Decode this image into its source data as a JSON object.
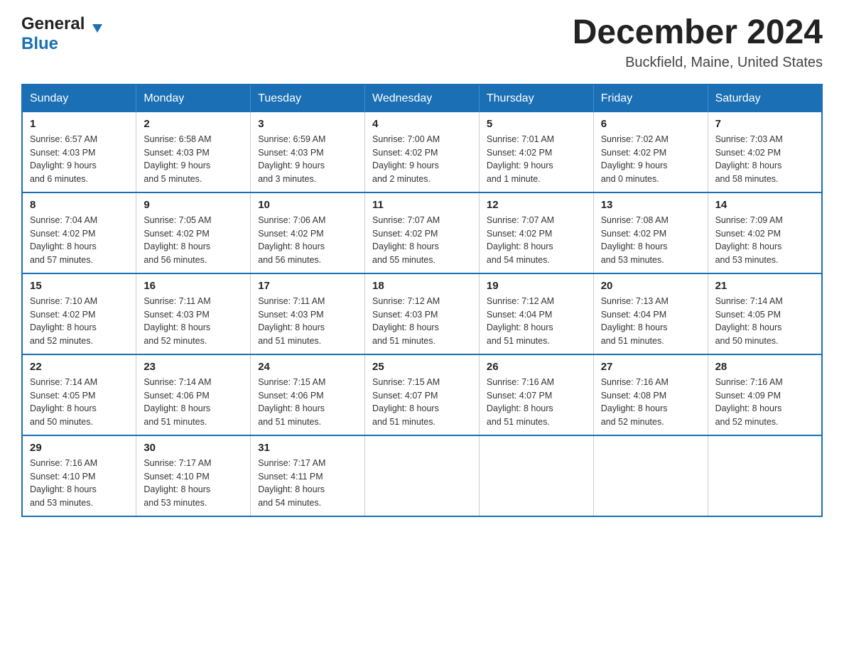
{
  "header": {
    "logo_line1": "General",
    "logo_line2": "Blue",
    "month_title": "December 2024",
    "location": "Buckfield, Maine, United States"
  },
  "weekdays": [
    "Sunday",
    "Monday",
    "Tuesday",
    "Wednesday",
    "Thursday",
    "Friday",
    "Saturday"
  ],
  "weeks": [
    [
      {
        "day": "1",
        "sunrise": "6:57 AM",
        "sunset": "4:03 PM",
        "daylight": "9 hours and 6 minutes."
      },
      {
        "day": "2",
        "sunrise": "6:58 AM",
        "sunset": "4:03 PM",
        "daylight": "9 hours and 5 minutes."
      },
      {
        "day": "3",
        "sunrise": "6:59 AM",
        "sunset": "4:03 PM",
        "daylight": "9 hours and 3 minutes."
      },
      {
        "day": "4",
        "sunrise": "7:00 AM",
        "sunset": "4:02 PM",
        "daylight": "9 hours and 2 minutes."
      },
      {
        "day": "5",
        "sunrise": "7:01 AM",
        "sunset": "4:02 PM",
        "daylight": "9 hours and 1 minute."
      },
      {
        "day": "6",
        "sunrise": "7:02 AM",
        "sunset": "4:02 PM",
        "daylight": "9 hours and 0 minutes."
      },
      {
        "day": "7",
        "sunrise": "7:03 AM",
        "sunset": "4:02 PM",
        "daylight": "8 hours and 58 minutes."
      }
    ],
    [
      {
        "day": "8",
        "sunrise": "7:04 AM",
        "sunset": "4:02 PM",
        "daylight": "8 hours and 57 minutes."
      },
      {
        "day": "9",
        "sunrise": "7:05 AM",
        "sunset": "4:02 PM",
        "daylight": "8 hours and 56 minutes."
      },
      {
        "day": "10",
        "sunrise": "7:06 AM",
        "sunset": "4:02 PM",
        "daylight": "8 hours and 56 minutes."
      },
      {
        "day": "11",
        "sunrise": "7:07 AM",
        "sunset": "4:02 PM",
        "daylight": "8 hours and 55 minutes."
      },
      {
        "day": "12",
        "sunrise": "7:07 AM",
        "sunset": "4:02 PM",
        "daylight": "8 hours and 54 minutes."
      },
      {
        "day": "13",
        "sunrise": "7:08 AM",
        "sunset": "4:02 PM",
        "daylight": "8 hours and 53 minutes."
      },
      {
        "day": "14",
        "sunrise": "7:09 AM",
        "sunset": "4:02 PM",
        "daylight": "8 hours and 53 minutes."
      }
    ],
    [
      {
        "day": "15",
        "sunrise": "7:10 AM",
        "sunset": "4:02 PM",
        "daylight": "8 hours and 52 minutes."
      },
      {
        "day": "16",
        "sunrise": "7:11 AM",
        "sunset": "4:03 PM",
        "daylight": "8 hours and 52 minutes."
      },
      {
        "day": "17",
        "sunrise": "7:11 AM",
        "sunset": "4:03 PM",
        "daylight": "8 hours and 51 minutes."
      },
      {
        "day": "18",
        "sunrise": "7:12 AM",
        "sunset": "4:03 PM",
        "daylight": "8 hours and 51 minutes."
      },
      {
        "day": "19",
        "sunrise": "7:12 AM",
        "sunset": "4:04 PM",
        "daylight": "8 hours and 51 minutes."
      },
      {
        "day": "20",
        "sunrise": "7:13 AM",
        "sunset": "4:04 PM",
        "daylight": "8 hours and 51 minutes."
      },
      {
        "day": "21",
        "sunrise": "7:14 AM",
        "sunset": "4:05 PM",
        "daylight": "8 hours and 50 minutes."
      }
    ],
    [
      {
        "day": "22",
        "sunrise": "7:14 AM",
        "sunset": "4:05 PM",
        "daylight": "8 hours and 50 minutes."
      },
      {
        "day": "23",
        "sunrise": "7:14 AM",
        "sunset": "4:06 PM",
        "daylight": "8 hours and 51 minutes."
      },
      {
        "day": "24",
        "sunrise": "7:15 AM",
        "sunset": "4:06 PM",
        "daylight": "8 hours and 51 minutes."
      },
      {
        "day": "25",
        "sunrise": "7:15 AM",
        "sunset": "4:07 PM",
        "daylight": "8 hours and 51 minutes."
      },
      {
        "day": "26",
        "sunrise": "7:16 AM",
        "sunset": "4:07 PM",
        "daylight": "8 hours and 51 minutes."
      },
      {
        "day": "27",
        "sunrise": "7:16 AM",
        "sunset": "4:08 PM",
        "daylight": "8 hours and 52 minutes."
      },
      {
        "day": "28",
        "sunrise": "7:16 AM",
        "sunset": "4:09 PM",
        "daylight": "8 hours and 52 minutes."
      }
    ],
    [
      {
        "day": "29",
        "sunrise": "7:16 AM",
        "sunset": "4:10 PM",
        "daylight": "8 hours and 53 minutes."
      },
      {
        "day": "30",
        "sunrise": "7:17 AM",
        "sunset": "4:10 PM",
        "daylight": "8 hours and 53 minutes."
      },
      {
        "day": "31",
        "sunrise": "7:17 AM",
        "sunset": "4:11 PM",
        "daylight": "8 hours and 54 minutes."
      },
      null,
      null,
      null,
      null
    ]
  ],
  "labels": {
    "sunrise": "Sunrise:",
    "sunset": "Sunset:",
    "daylight": "Daylight:"
  }
}
